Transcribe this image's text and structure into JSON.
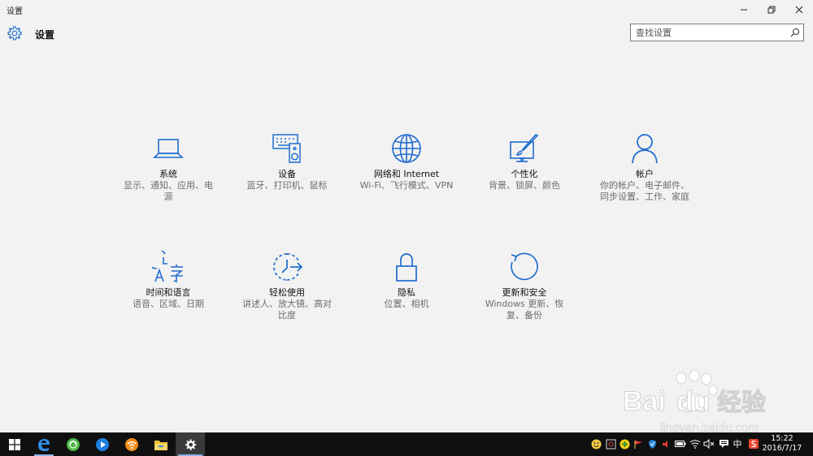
{
  "window": {
    "title": "设置"
  },
  "header": {
    "title": "设置"
  },
  "search": {
    "placeholder": "查找设置"
  },
  "accent": "#1e6ccf",
  "tiles": [
    {
      "icon": "laptop-icon",
      "label": "系统",
      "desc": "显示、通知、应用、电源"
    },
    {
      "icon": "keyboard-speaker-icon",
      "label": "设备",
      "desc": "蓝牙、打印机、鼠标"
    },
    {
      "icon": "globe-icon",
      "label": "网络和 Internet",
      "desc": "Wi-Fi、飞行模式、VPN"
    },
    {
      "icon": "paint-brush-icon",
      "label": "个性化",
      "desc": "背景、锁屏、颜色"
    },
    {
      "icon": "person-icon",
      "label": "帐户",
      "desc": "你的帐户、电子邮件、同步设置、工作、家庭"
    },
    {
      "icon": "time-language-icon",
      "label": "时间和语言",
      "desc": "语音、区域、日期"
    },
    {
      "icon": "ease-of-access-icon",
      "label": "轻松使用",
      "desc": "讲述人、放大镜、高对比度"
    },
    {
      "icon": "lock-icon",
      "label": "隐私",
      "desc": "位置、相机"
    },
    {
      "icon": "update-icon",
      "label": "更新和安全",
      "desc": "Windows 更新、恢复、备份"
    }
  ],
  "tray": {
    "ime": "中"
  },
  "clock": {
    "time": "15:22",
    "date": "2016/7/17"
  },
  "watermark": {
    "brand": "Baidu",
    "product": "经验",
    "url": "jingyan.baidu.com"
  }
}
